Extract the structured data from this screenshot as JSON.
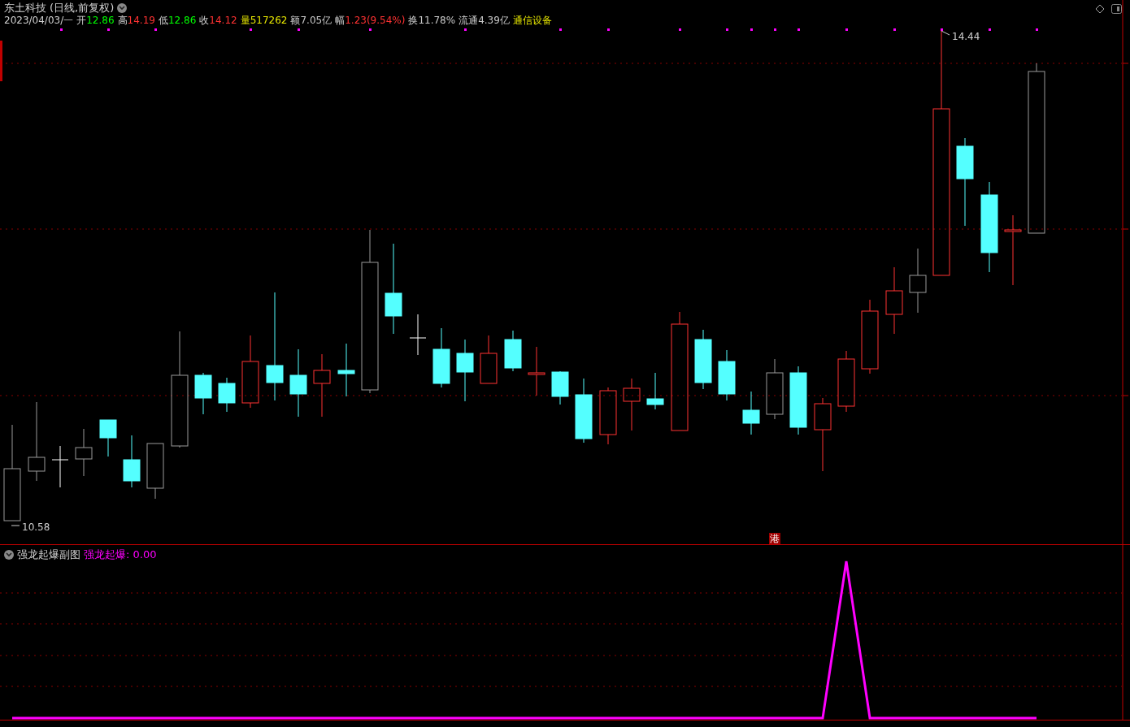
{
  "main_chart": {
    "title": "东土科技",
    "period": "(日线,前复权)",
    "date": "2023/04/03/一",
    "quote": [
      {
        "label": "开",
        "value": "12.86",
        "color": "#00ff00"
      },
      {
        "label": "高",
        "value": "14.19",
        "color": "#ff3232"
      },
      {
        "label": "低",
        "value": "12.86",
        "color": "#00ff00"
      },
      {
        "label": "收",
        "value": "14.12",
        "color": "#ff3232"
      },
      {
        "label": "量",
        "value": "517262",
        "color": "#e6e600"
      },
      {
        "label": "额",
        "value": "7.05亿",
        "color": "#c8c8c8"
      },
      {
        "label": "幅",
        "value": "1.23(9.54%)",
        "color": "#ff3232"
      },
      {
        "label": "换",
        "value": "11.78%",
        "color": "#c8c8c8"
      },
      {
        "label": "流通",
        "value": "4.39亿",
        "color": "#c8c8c8"
      }
    ],
    "sector": "通信设备",
    "high_label": "14.44",
    "low_label": "10.58",
    "marker": "港"
  },
  "sub_chart": {
    "title": "强龙起爆副图",
    "indicator": "强龙起爆: 0.00"
  }
}
